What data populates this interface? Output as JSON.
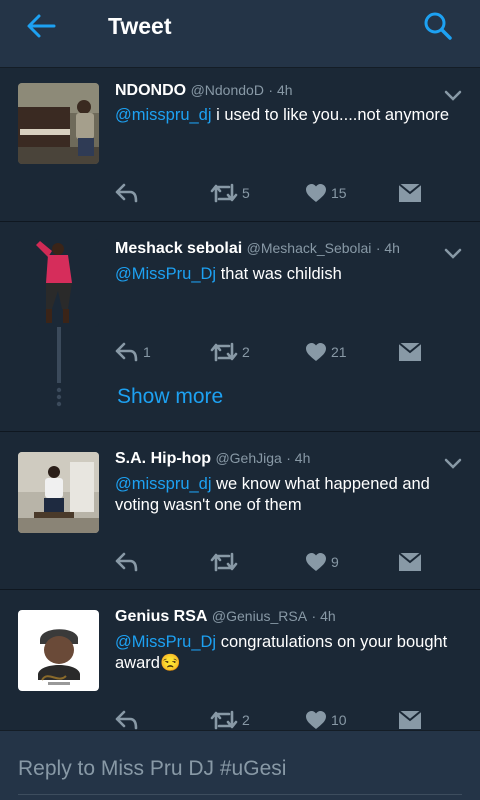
{
  "header": {
    "title": "Tweet"
  },
  "tweets": [
    {
      "name": "NDONDO",
      "handle": "@NdondoD",
      "time": "· 4h",
      "mention": "@misspru_dj",
      "text": " i used to like you....not anymore",
      "reply_count": "",
      "retweet_count": "5",
      "like_count": "15"
    },
    {
      "name": "Meshack sebolai",
      "handle": "@Meshack_Sebolai",
      "time": "· 4h",
      "mention": "@MissPru_Dj",
      "text": " that was childish",
      "reply_count": "1",
      "retweet_count": "2",
      "like_count": "21"
    },
    {
      "name": "S.A. Hip-hop",
      "handle": "@GehJiga",
      "time": "· 4h",
      "mention": "@misspru_dj",
      "text": " we know what happened and voting wasn't one of them",
      "reply_count": "",
      "retweet_count": "",
      "like_count": "9"
    },
    {
      "name": "Genius RSA",
      "handle": "@Genius_RSA",
      "time": "· 4h",
      "mention": "@MissPru_Dj",
      "text": " congratulations on your bought award",
      "emoji": "😒",
      "reply_count": "",
      "retweet_count": "2",
      "like_count": "10"
    }
  ],
  "thread": {
    "show_more": "Show more"
  },
  "compose": {
    "placeholder": "Reply to Miss Pru DJ #uGesi"
  },
  "colors": {
    "background": "#1b2836",
    "bar": "#243447",
    "accent": "#1da1f2",
    "secondary": "#8899a6"
  },
  "icons": [
    "back-arrow-icon",
    "search-icon",
    "chevron-down-icon",
    "reply-icon",
    "retweet-icon",
    "heart-icon",
    "direct-message-icon"
  ]
}
